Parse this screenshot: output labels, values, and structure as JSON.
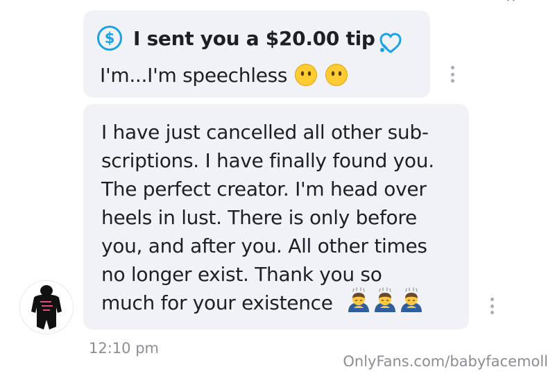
{
  "tip_message": {
    "tip_label": "I sent you a $20.00 tip",
    "caption": "I'm...I'm speechless",
    "currency_icon": "dollar-circle-icon",
    "heart_icon": "heart-outline-icon",
    "emojis": [
      "face-without-mouth",
      "face-without-mouth"
    ]
  },
  "text_message": {
    "body": "I have just cancelled all other sub-\nscriptions. I have finally found you.\nThe perfect creator. I'm head over\nheels in lust. There is only before\nyou, and after you. All other times\nno longer exist. Thank you so\nmuch for your existence",
    "emojis": [
      "person-bowing",
      "person-bowing",
      "person-bowing"
    ]
  },
  "timestamp": "12:10 pm",
  "watermark": "OnlyFans.com/babyfacemoll",
  "colors": {
    "accent": "#1aa3e0",
    "bubble": "#f0f2f5",
    "meta_text": "#8a8d93"
  }
}
